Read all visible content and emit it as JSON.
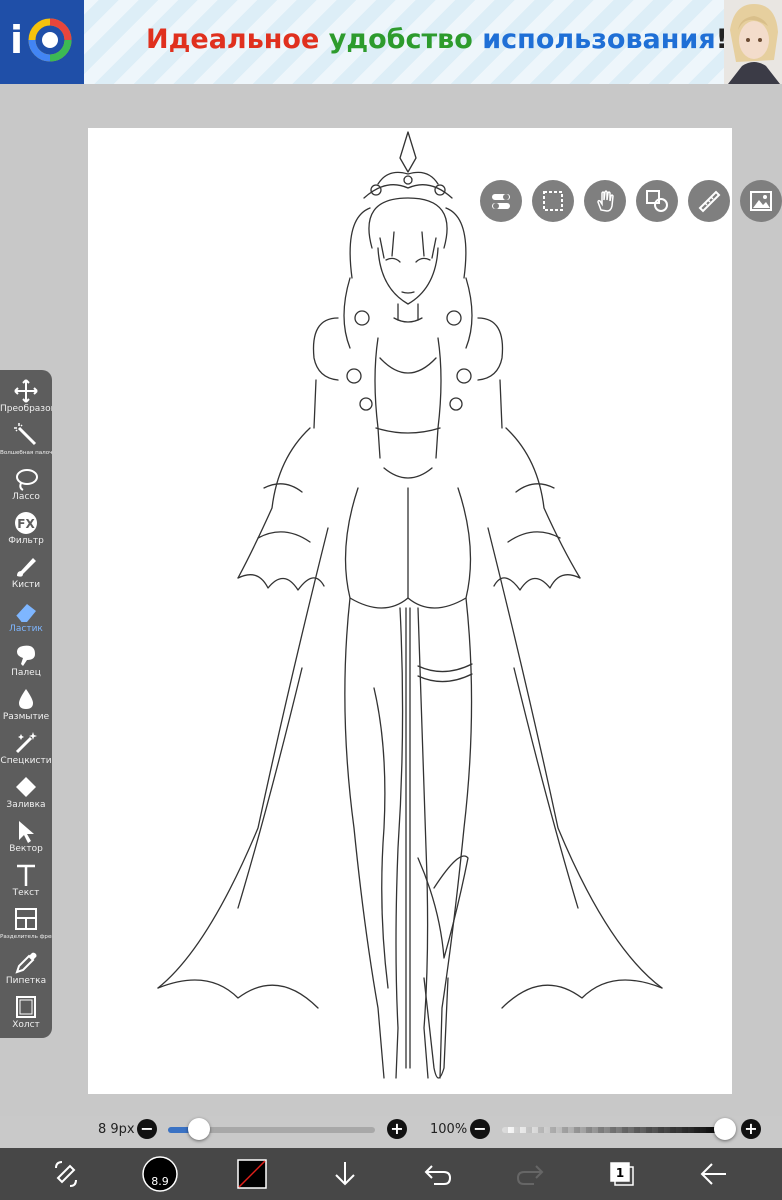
{
  "banner": {
    "logo_letter": "i",
    "headline_parts": [
      "Идеальное",
      " ",
      "удобство",
      " ",
      "использования",
      "!"
    ],
    "headline_colors": [
      "#e0301e",
      "#000000",
      "#2d9b2d",
      "#000000",
      "#1f6fd6",
      "#222222"
    ],
    "avatar": "avatar-portrait"
  },
  "top_tools": [
    {
      "name": "toggle-icon"
    },
    {
      "name": "selection-icon"
    },
    {
      "name": "hand-icon"
    },
    {
      "name": "shapes-icon"
    },
    {
      "name": "ruler-icon"
    },
    {
      "name": "image-icon"
    }
  ],
  "toolbar": {
    "items": [
      {
        "label": "Преобразовать",
        "icon": "move-icon",
        "small": false,
        "active": false
      },
      {
        "label": "Волшебная палочка",
        "icon": "magic-wand-icon",
        "small": true,
        "active": false
      },
      {
        "label": "Лассо",
        "icon": "lasso-icon",
        "small": false,
        "active": false
      },
      {
        "label": "Фильтр",
        "icon": "fx-icon",
        "small": false,
        "active": false
      },
      {
        "label": "Кисти",
        "icon": "brush-icon",
        "small": false,
        "active": false
      },
      {
        "label": "Ластик",
        "icon": "eraser-icon",
        "small": false,
        "active": true
      },
      {
        "label": "Палец",
        "icon": "smudge-icon",
        "small": false,
        "active": false
      },
      {
        "label": "Размытие",
        "icon": "blur-icon",
        "small": false,
        "active": false
      },
      {
        "label": "Спецкисти",
        "icon": "special-brush-icon",
        "small": false,
        "active": false
      },
      {
        "label": "Заливка",
        "icon": "fill-icon",
        "small": false,
        "active": false
      },
      {
        "label": "Вектор",
        "icon": "vector-icon",
        "small": false,
        "active": false
      },
      {
        "label": "Текст",
        "icon": "text-icon",
        "small": false,
        "active": false
      },
      {
        "label": "Разделитель фреймов",
        "icon": "frame-divider-icon",
        "small": true,
        "active": false
      },
      {
        "label": "Пипетка",
        "icon": "eyedropper-icon",
        "small": false,
        "active": false
      },
      {
        "label": "Холст",
        "icon": "canvas-icon",
        "small": false,
        "active": false
      }
    ],
    "active_color": "#7eb6ff"
  },
  "sliders": {
    "size_label": "8 9px",
    "size_fraction": 0.15,
    "opacity_label": "100%",
    "opacity_fraction": 1.0,
    "minus_symbol": "−",
    "plus_symbol": "+",
    "accent": "#3a72c4"
  },
  "bottom_bar": {
    "brush_size_text": "8.9",
    "layer_count": "1",
    "icons": [
      "swap-erase-icon",
      "brush-preview-icon",
      "color-swatch-icon",
      "download-icon",
      "undo-icon",
      "redo-icon",
      "layers-icon",
      "back-arrow-icon"
    ]
  }
}
